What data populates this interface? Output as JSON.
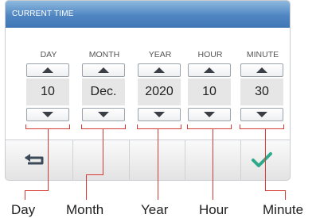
{
  "title": "CURRENT TIME",
  "fields": [
    {
      "label": "DAY",
      "value": "10",
      "callout": "Day"
    },
    {
      "label": "MONTH",
      "value": "Dec.",
      "callout": "Month"
    },
    {
      "label": "YEAR",
      "value": "2020",
      "callout": "Year"
    },
    {
      "label": "HOUR",
      "value": "10",
      "callout": "Hour"
    },
    {
      "label": "MINUTE",
      "value": "30",
      "callout": "Minute"
    }
  ],
  "icons": {
    "up": "triangle-up-icon",
    "down": "triangle-down-icon",
    "back": "return-arrow-icon",
    "confirm": "checkmark-icon"
  },
  "colors": {
    "titlebar": "#4f86c2",
    "value_bg": "#e6e6e6",
    "callout": "#d63b33",
    "confirm": "#2eaa8a"
  }
}
